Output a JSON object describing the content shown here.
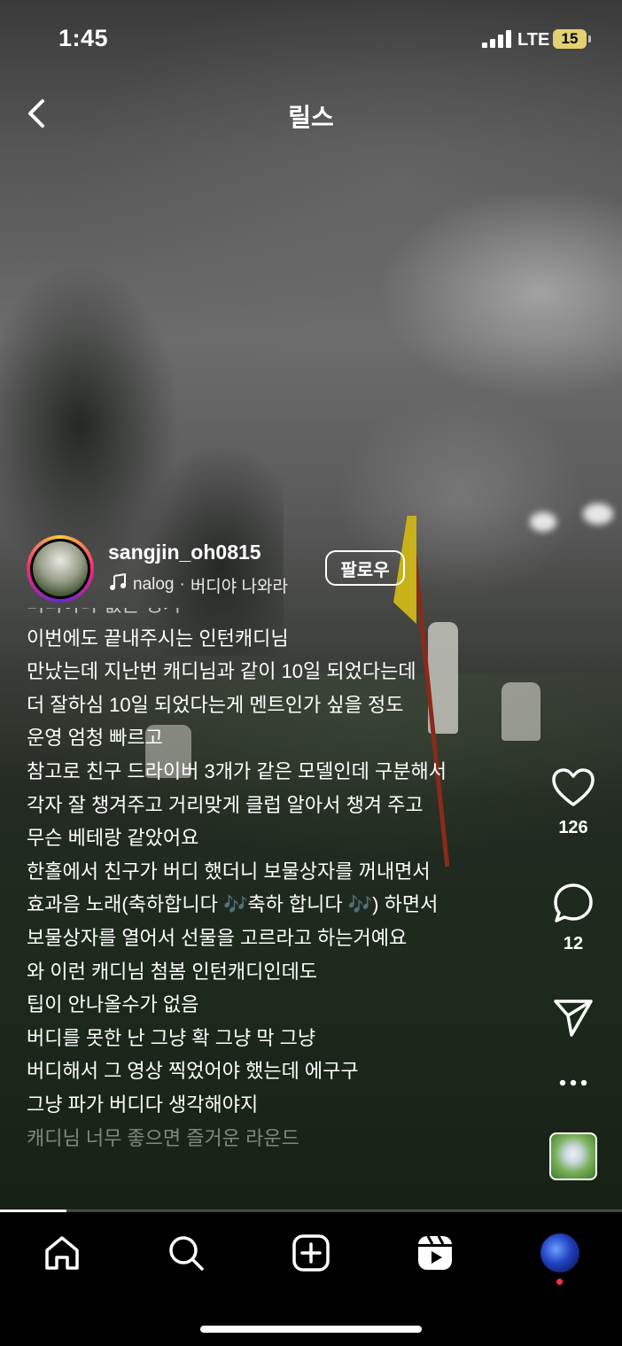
{
  "status_bar": {
    "time": "1:45",
    "network": "LTE",
    "battery": "15"
  },
  "header": {
    "title": "릴스"
  },
  "profile": {
    "username": "sangjin_oh0815",
    "music_artist": "nalog",
    "music_separator": "·",
    "music_title": "버디야 나와라",
    "follow_label": "팔로우"
  },
  "caption_lines": [
    "버디아나 없는 경기",
    "이번에도 끝내주시는 인턴캐디님",
    "만났는데 지난번 캐디님과 같이 10일 되었다는데",
    "더 잘하심 10일 되었다는게 멘트인가 싶을 정도",
    "운영 엄청 빠르고",
    "참고로 친구 드라이버 3개가 같은 모델인데 구분해서",
    "각자 잘 챙겨주고 거리맞게 클럽 알아서 챙겨 주고",
    "무슨 베테랑 같았어요",
    "한홀에서 친구가 버디 했더니  보물상자를 꺼내면서",
    "효과음 노래(축하합니다 🎶축하 합니다 🎶) 하면서",
    "보물상자를 열어서 선물을 고르라고 하는거예요",
    "와 이런 캐디님 첨봄  인턴캐디인데도",
    "팁이 안나올수가 없음",
    "버디를 못한 난 그냥 확 그냥 막 그냥",
    "버디해서 그 영상 찍었어야 했는데 에구구",
    "그냥 파가 버디다 생각해야지",
    "캐디님 너무 좋으면 즐거운 라운드"
  ],
  "actions": {
    "likes": "126",
    "comments": "12"
  },
  "video_progress": 0.107,
  "icons": {
    "back": "chevron-left-icon",
    "music": "music-note-icon",
    "like": "heart-icon",
    "comment": "comment-bubble-icon",
    "share": "paper-plane-icon",
    "more": "more-dots-icon",
    "home": "home-icon",
    "search": "search-icon",
    "create": "plus-square-icon",
    "reels": "reels-icon"
  },
  "colors": {
    "accent_dot": "#ff3040",
    "battery": "#e3d070"
  }
}
